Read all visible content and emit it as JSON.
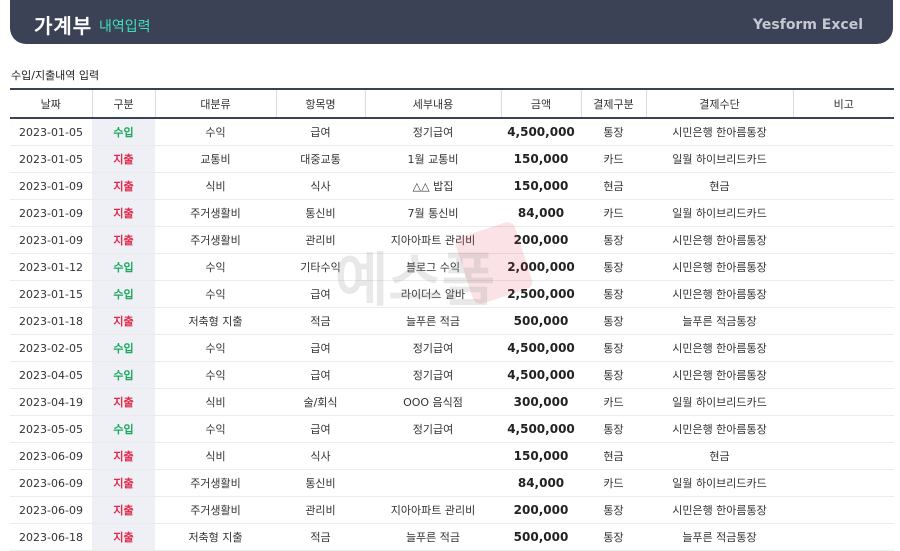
{
  "header": {
    "title": "가계부",
    "subtitle": "내역입력",
    "brand": "Yesform Excel"
  },
  "section_title": "수입/지출내역 입력",
  "columns": [
    "날짜",
    "구분",
    "대분류",
    "항목명",
    "세부내용",
    "금액",
    "결제구분",
    "결제수단",
    "비고"
  ],
  "rows": [
    {
      "date": "2023-01-05",
      "type": "수입",
      "category": "수익",
      "item": "급여",
      "detail": "정기급여",
      "amount": "4,500,000",
      "pay_type": "통장",
      "pay_method": "시민은행 한아름통장",
      "note": ""
    },
    {
      "date": "2023-01-05",
      "type": "지출",
      "category": "교통비",
      "item": "대중교통",
      "detail": "1월 교통비",
      "amount": "150,000",
      "pay_type": "카드",
      "pay_method": "일월 하이브리드카드",
      "note": ""
    },
    {
      "date": "2023-01-09",
      "type": "지출",
      "category": "식비",
      "item": "식사",
      "detail": "△△ 밥집",
      "amount": "150,000",
      "pay_type": "현금",
      "pay_method": "현금",
      "note": ""
    },
    {
      "date": "2023-01-09",
      "type": "지출",
      "category": "주거생활비",
      "item": "통신비",
      "detail": "7월 통신비",
      "amount": "84,000",
      "pay_type": "카드",
      "pay_method": "일월 하이브리드카드",
      "note": ""
    },
    {
      "date": "2023-01-09",
      "type": "지출",
      "category": "주거생활비",
      "item": "관리비",
      "detail": "지아아파트 관리비",
      "amount": "200,000",
      "pay_type": "통장",
      "pay_method": "시민은행 한아름통장",
      "note": ""
    },
    {
      "date": "2023-01-12",
      "type": "수입",
      "category": "수익",
      "item": "기타수익",
      "detail": "블로그 수익",
      "amount": "2,000,000",
      "pay_type": "통장",
      "pay_method": "시민은행 한아름통장",
      "note": ""
    },
    {
      "date": "2023-01-15",
      "type": "수입",
      "category": "수익",
      "item": "급여",
      "detail": "라이더스 알바",
      "amount": "2,500,000",
      "pay_type": "통장",
      "pay_method": "시민은행 한아름통장",
      "note": ""
    },
    {
      "date": "2023-01-18",
      "type": "지출",
      "category": "저축형 지출",
      "item": "적금",
      "detail": "늘푸른 적금",
      "amount": "500,000",
      "pay_type": "통장",
      "pay_method": "늘푸른 적금통장",
      "note": ""
    },
    {
      "date": "2023-02-05",
      "type": "수입",
      "category": "수익",
      "item": "급여",
      "detail": "정기급여",
      "amount": "4,500,000",
      "pay_type": "통장",
      "pay_method": "시민은행 한아름통장",
      "note": ""
    },
    {
      "date": "2023-04-05",
      "type": "수입",
      "category": "수익",
      "item": "급여",
      "detail": "정기급여",
      "amount": "4,500,000",
      "pay_type": "통장",
      "pay_method": "시민은행 한아름통장",
      "note": ""
    },
    {
      "date": "2023-04-19",
      "type": "지출",
      "category": "식비",
      "item": "술/회식",
      "detail": "OOO 음식점",
      "amount": "300,000",
      "pay_type": "카드",
      "pay_method": "일월 하이브리드카드",
      "note": ""
    },
    {
      "date": "2023-05-05",
      "type": "수입",
      "category": "수익",
      "item": "급여",
      "detail": "정기급여",
      "amount": "4,500,000",
      "pay_type": "통장",
      "pay_method": "시민은행 한아름통장",
      "note": ""
    },
    {
      "date": "2023-06-09",
      "type": "지출",
      "category": "식비",
      "item": "식사",
      "detail": "",
      "amount": "150,000",
      "pay_type": "현금",
      "pay_method": "현금",
      "note": ""
    },
    {
      "date": "2023-06-09",
      "type": "지출",
      "category": "주거생활비",
      "item": "통신비",
      "detail": "",
      "amount": "84,000",
      "pay_type": "카드",
      "pay_method": "일월 하이브리드카드",
      "note": ""
    },
    {
      "date": "2023-06-09",
      "type": "지출",
      "category": "주거생활비",
      "item": "관리비",
      "detail": "지아아파트 관리비",
      "amount": "200,000",
      "pay_type": "통장",
      "pay_method": "시민은행 한아름통장",
      "note": ""
    },
    {
      "date": "2023-06-18",
      "type": "지출",
      "category": "저축형 지출",
      "item": "적금",
      "detail": "늘푸른 적금",
      "amount": "500,000",
      "pay_type": "통장",
      "pay_method": "늘푸른 적금통장",
      "note": ""
    }
  ],
  "type_colors": {
    "income": "#1aa85c",
    "expense": "#e0284a"
  },
  "watermark": {
    "text": "예스폼"
  }
}
